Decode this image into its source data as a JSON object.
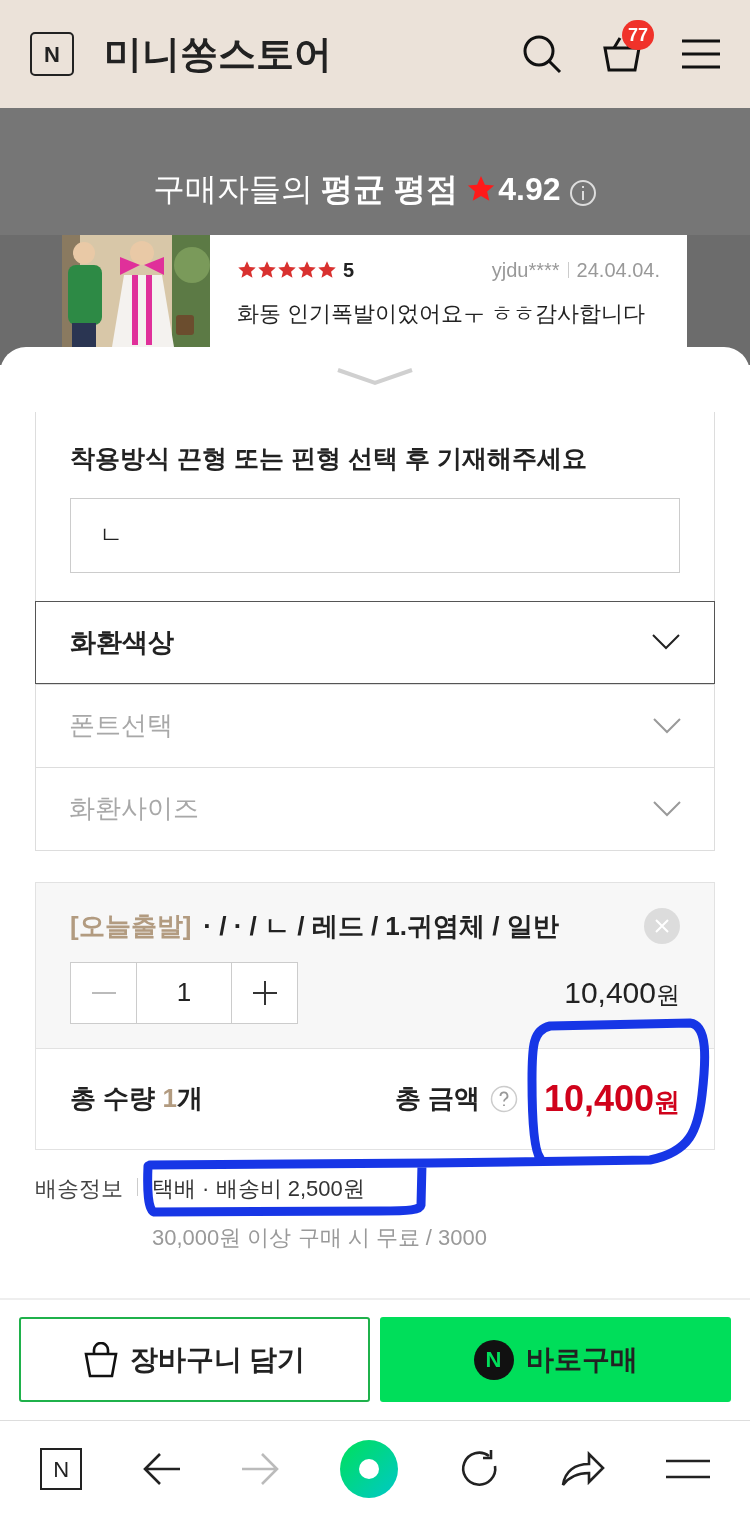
{
  "header": {
    "logo_letter": "N",
    "store_name": "미니쏭스토어",
    "cart_count": "77"
  },
  "rating_banner": {
    "prefix": "구매자들의",
    "label": "평균 평점",
    "score": "4.92"
  },
  "review": {
    "stars": 5,
    "score": "5",
    "user": "yjdu****",
    "date": "24.04.04.",
    "text": "화동 인기폭발이었어요ㅜ ㅎㅎ감사합니다"
  },
  "options": {
    "instruction": "착용방식 끈형 또는 핀형 선택 후 기재해주세요",
    "input_value": "ㄴ",
    "dropdowns": [
      {
        "label": "화환색상",
        "disabled": false
      },
      {
        "label": "폰트선택",
        "disabled": true
      },
      {
        "label": "화환사이즈",
        "disabled": true
      }
    ]
  },
  "selected_item": {
    "tag": "[오늘출발]",
    "option_text": "· / · / ㄴ / 레드 / 1.귀염체 / 일반",
    "quantity": "1",
    "price": "10,400",
    "currency": "원"
  },
  "total": {
    "qty_label": "총 수량",
    "qty": "1",
    "qty_unit": "개",
    "amount_label": "총 금액",
    "amount": "10,400",
    "currency": "원"
  },
  "shipping": {
    "label": "배송정보",
    "method": "택배 · 배송비 2,500원",
    "note": "30,000원 이상 구매 시 무료 / 3000"
  },
  "actions": {
    "cart_button": "장바구니 담기",
    "buy_logo_letter": "N",
    "buy_button": "바로구매"
  },
  "browser_nav": {
    "logo_letter": "N",
    "forward_disabled": true
  }
}
